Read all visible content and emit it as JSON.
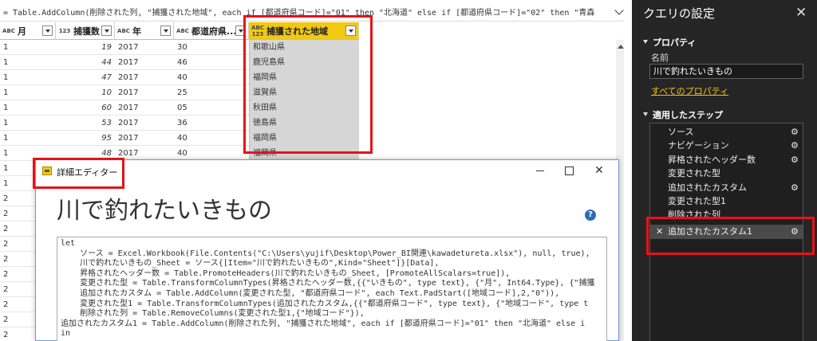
{
  "formula_bar": {
    "text": "= Table.AddColumn(削除された列, \"捕獲された地域\", each if [都道府県コード]=\"01\" then \"北海道\" else if [都道府県コード]=\"02\" then \"青森"
  },
  "grid": {
    "columns": [
      {
        "type": "ABC",
        "name": "月"
      },
      {
        "type": "123",
        "name": "捕獲数"
      },
      {
        "type": "ABC",
        "name": "年"
      },
      {
        "type": "ABC",
        "name": "都道府県..."
      },
      {
        "type": "ABC 123",
        "name": "捕獲された地域"
      }
    ],
    "rows": [
      [
        "1",
        "19",
        "2017",
        "30",
        "和歌山県"
      ],
      [
        "1",
        "44",
        "2017",
        "46",
        "鹿児島県"
      ],
      [
        "1",
        "47",
        "2017",
        "40",
        "福岡県"
      ],
      [
        "1",
        "10",
        "2017",
        "25",
        "滋賀県"
      ],
      [
        "1",
        "60",
        "2017",
        "05",
        "秋田県"
      ],
      [
        "1",
        "53",
        "2017",
        "36",
        "徳島県"
      ],
      [
        "1",
        "95",
        "2017",
        "40",
        "福岡県"
      ],
      [
        "1",
        "48",
        "2017",
        "40",
        "福岡県"
      ],
      [
        "1",
        "",
        "",
        "",
        ""
      ],
      [
        "1",
        "",
        "",
        "",
        ""
      ],
      [
        "2",
        "",
        "",
        "",
        ""
      ],
      [
        "2",
        "",
        "",
        "",
        ""
      ],
      [
        "2",
        "",
        "",
        "",
        ""
      ],
      [
        "2",
        "",
        "",
        "",
        ""
      ],
      [
        "2",
        "",
        "",
        "",
        ""
      ],
      [
        "2",
        "",
        "",
        "",
        ""
      ],
      [
        "2",
        "",
        "",
        "",
        ""
      ],
      [
        "2",
        "",
        "",
        "",
        ""
      ],
      [
        "2",
        "",
        "",
        "",
        ""
      ],
      [
        "2",
        "",
        "",
        "",
        ""
      ]
    ]
  },
  "dialog": {
    "title": "詳細エディター",
    "heading": "川で釣れたいきもの",
    "help": "?",
    "code": "let\n    ソース = Excel.Workbook(File.Contents(\"C:\\Users\\yujif\\Desktop\\Power_BI関連\\kawadetureta.xlsx\"), null, true),\n    川で釣れたいきもの_Sheet = ソース{[Item=\"川で釣れたいきもの\",Kind=\"Sheet\"]}[Data],\n    昇格されたヘッダー数 = Table.PromoteHeaders(川で釣れたいきもの_Sheet, [PromoteAllScalars=true]),\n    変更された型 = Table.TransformColumnTypes(昇格されたヘッダー数,{{\"いきもの\", type text}, {\"月\", Int64.Type}, {\"捕獲\n    追加されたカスタム = Table.AddColumn(変更された型, \"都道府県コード\", each Text.PadStart([地域コード],2,\"0\")),\n    変更された型1 = Table.TransformColumnTypes(追加されたカスタム,{{\"都道府県コード\", type text}, {\"地域コード\", type t\n    削除された列 = Table.RemoveColumns(変更された型1,{\"地域コード\"}),\n追加されたカスタム1 = Table.AddColumn(削除された列, \"捕獲された地域\", each if [都道府県コード]=\"01\" then \"北海道\" else i\nin"
  },
  "panel": {
    "title": "クエリの設定",
    "close": "✕",
    "properties_title": "プロパティ",
    "name_label": "名前",
    "name_value": "川で釣れたいきもの",
    "all_properties_link": "すべてのプロパティ",
    "steps_title": "適用したステップ",
    "steps": [
      {
        "label": "ソース",
        "gear": true
      },
      {
        "label": "ナビゲーション",
        "gear": true
      },
      {
        "label": "昇格されたヘッダー数",
        "gear": true
      },
      {
        "label": "変更された型",
        "gear": false
      },
      {
        "label": "追加されたカスタム",
        "gear": true
      },
      {
        "label": "変更された型1",
        "gear": false
      },
      {
        "label": "削除された列",
        "gear": false
      },
      {
        "label": "追加されたカスタム1",
        "gear": true,
        "active": true
      }
    ]
  },
  "colors": {
    "highlight_yellow": "#f2c811",
    "annotation_red": "#e8111a",
    "panel_bg": "#252525"
  }
}
